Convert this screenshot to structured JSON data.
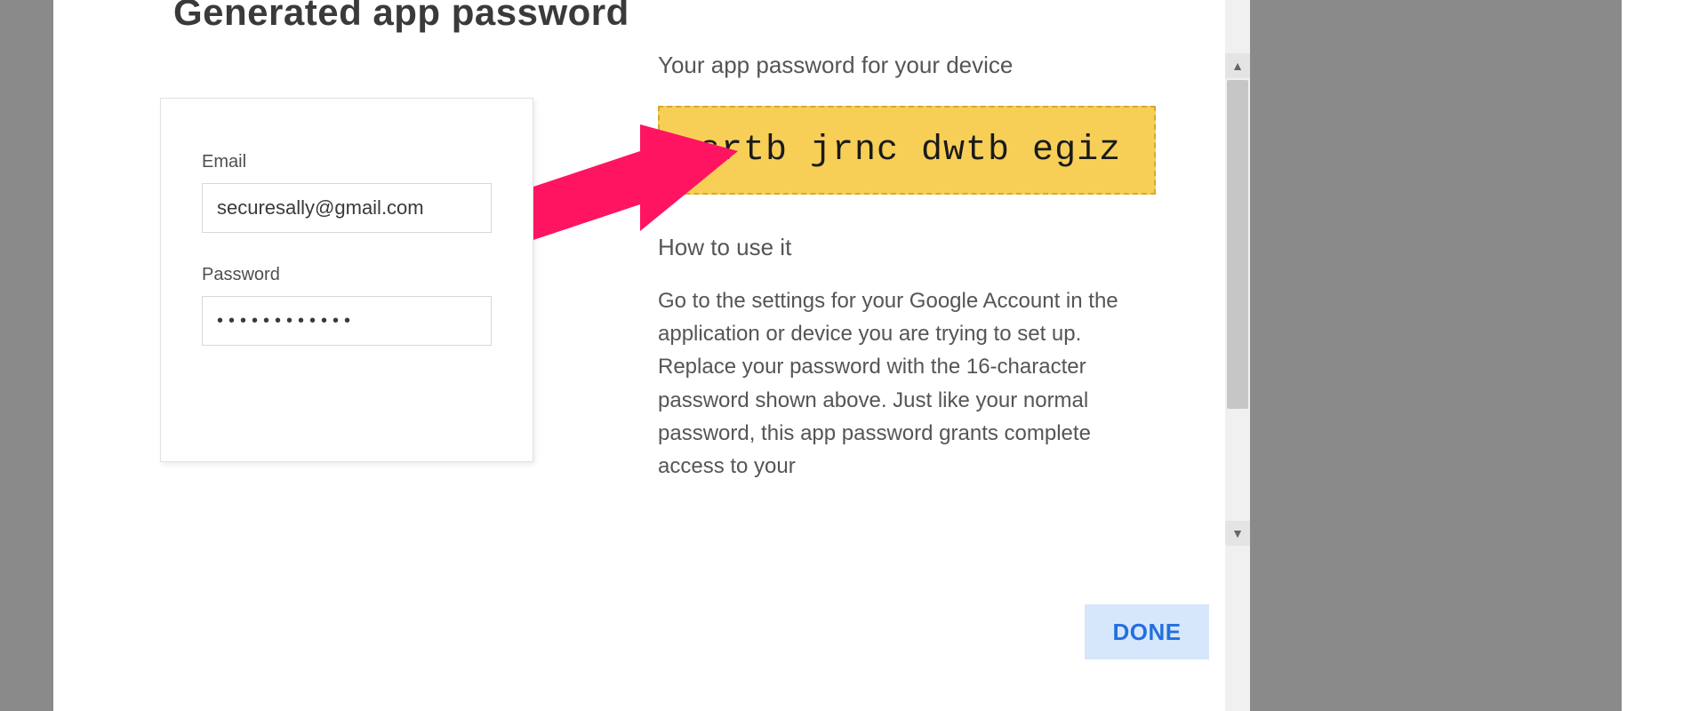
{
  "modal": {
    "title": "Generated app password",
    "subheading": "Your app password for your device",
    "password_display": "srtb jrnc dwtb egiz",
    "howto_heading": "How to use it",
    "howto_body": "Go to the settings for your Google Account in the application or device you are trying to set up. Replace your password with the 16-character password shown above.\nJust like your normal password, this app password grants complete access to your",
    "done_label": "DONE"
  },
  "login_card": {
    "email_label": "Email",
    "email_value": "securesally@gmail.com",
    "password_label": "Password",
    "password_masked": "••••••••••••"
  },
  "annotation": {
    "arrow_color": "#ff1462"
  },
  "scrollbar": {
    "up_glyph": "▲",
    "down_glyph": "▼"
  }
}
